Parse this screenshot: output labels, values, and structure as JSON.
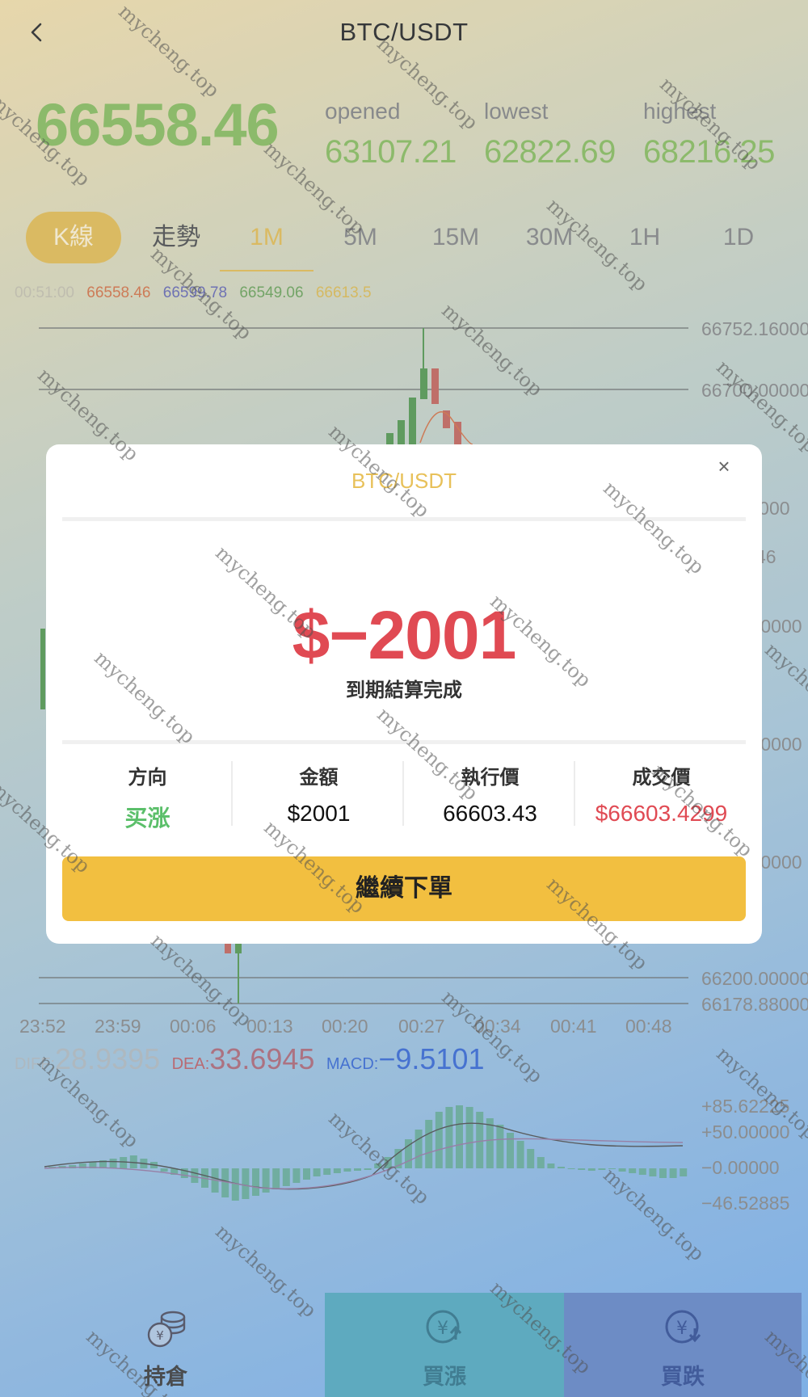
{
  "header": {
    "title": "BTC/USDT"
  },
  "price": {
    "current": "66558.46",
    "opened_label": "opened",
    "opened": "63107.21",
    "lowest_label": "lowest",
    "lowest": "62822.69",
    "highest_label": "highest",
    "highest": "68216.25"
  },
  "tabs": [
    {
      "label": "K線"
    },
    {
      "label": "走勢"
    },
    {
      "label": "1M"
    },
    {
      "label": "5M"
    },
    {
      "label": "15M"
    },
    {
      "label": "30M"
    },
    {
      "label": "1H"
    },
    {
      "label": "1D"
    }
  ],
  "legend": {
    "time": "00:51:00",
    "open": "66558.46",
    "high": "66599.78",
    "low": "66549.06",
    "close": "66613.5"
  },
  "price_axis": [
    "66752.16000",
    "66700.00000",
    ".0000",
    "46",
    ".0000",
    ".0000",
    ".0000",
    "66200.00000",
    "66178.88000"
  ],
  "time_axis": [
    "23:52",
    "23:59",
    "00:06",
    "00:13",
    "00:20",
    "00:27",
    "00:34",
    "00:41",
    "00:48"
  ],
  "macd": {
    "diff_label": "DIFF:",
    "diff": "28.9395",
    "dea_label": "DEA:",
    "dea": "33.6945",
    "macd_label": "MACD:",
    "macd": "−9.5101",
    "axis": [
      "+85.62225",
      "+50.00000",
      "−0.00000",
      "−46.52885"
    ]
  },
  "dialog": {
    "title": "BTC/USDT",
    "close_icon": "×",
    "amount": "$−2001",
    "status": "到期結算完成",
    "columns": [
      {
        "header": "方向",
        "value": "买涨"
      },
      {
        "header": "金額",
        "value": "$2001"
      },
      {
        "header": "執行價",
        "value": "66603.43"
      },
      {
        "header": "成交價",
        "value": "$66603.4299"
      }
    ],
    "button": "繼續下單"
  },
  "bottom": {
    "positions": "持倉",
    "buy_up": "買漲",
    "buy_down": "買跌"
  },
  "watermark": "mycheng.top",
  "colors": {
    "green": "#8fc165",
    "red": "#e04a53",
    "gold": "#e8c15a",
    "blue": "#3f6fd8"
  }
}
